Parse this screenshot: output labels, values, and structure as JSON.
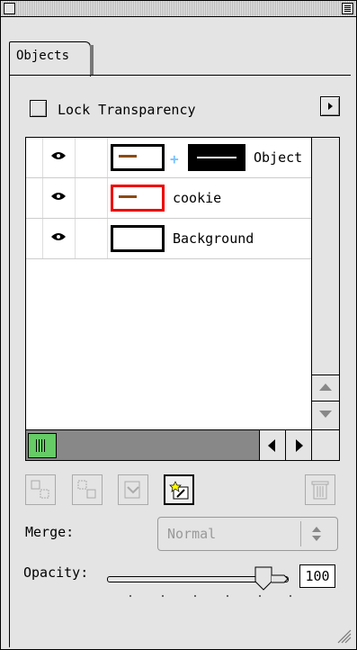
{
  "window": {
    "tab_label": "Objects"
  },
  "options": {
    "lock_transparency_label": "Lock Transparency",
    "lock_transparency_checked": false
  },
  "objects": {
    "rows": [
      {
        "name": "Object",
        "visible": true,
        "has_mask": true,
        "thumb_border": "#000000"
      },
      {
        "name": "cookie",
        "visible": true,
        "has_mask": false,
        "thumb_border": "#e00000"
      },
      {
        "name": "Background",
        "visible": true,
        "has_mask": false,
        "thumb_border": "#000000"
      }
    ]
  },
  "merge": {
    "label": "Merge:",
    "value": "Normal"
  },
  "opacity": {
    "label": "Opacity:",
    "value": "100",
    "level": 1.0
  },
  "icons": [
    "close-box-icon",
    "zoom-box-icon",
    "panel-menu-icon",
    "eye-icon",
    "link-icon",
    "scroll-up-icon",
    "scroll-down-icon",
    "scroll-left-icon",
    "scroll-right-icon",
    "group-icon",
    "ungroup-icon",
    "merge-down-icon",
    "new-object-icon",
    "trash-icon",
    "grow-box-icon"
  ]
}
